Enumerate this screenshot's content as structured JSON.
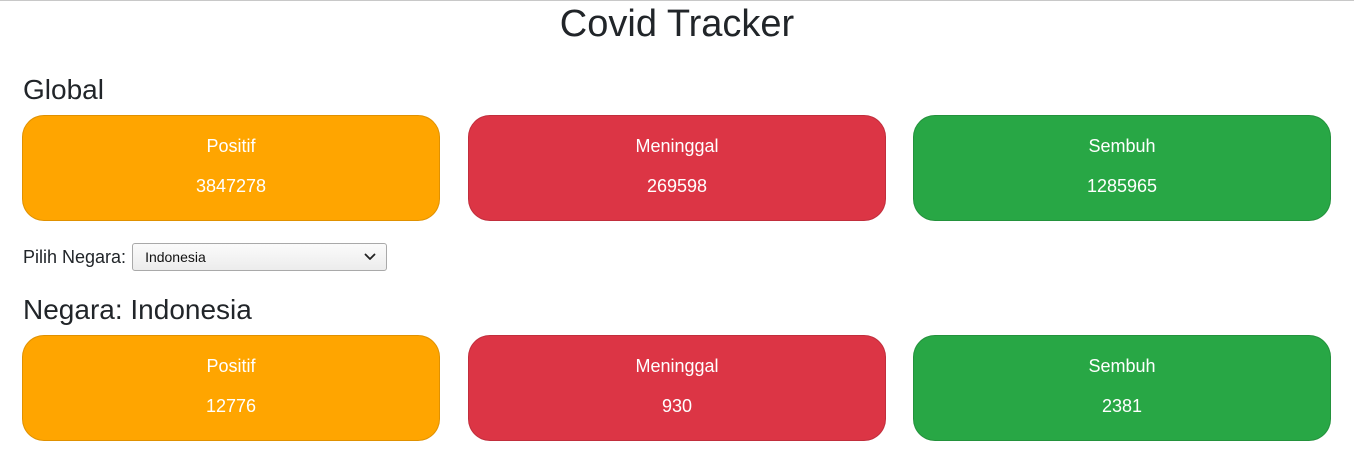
{
  "app": {
    "title": "Covid Tracker"
  },
  "colors": {
    "positive": "#ffa500",
    "deaths": "#dc3545",
    "recovered": "#28a745"
  },
  "global": {
    "title": "Global",
    "cards": [
      {
        "label": "Positif",
        "value": "3847278"
      },
      {
        "label": "Meninggal",
        "value": "269598"
      },
      {
        "label": "Sembuh",
        "value": "1285965"
      }
    ]
  },
  "country_select": {
    "label": "Pilih Negara:",
    "selected": "Indonesia",
    "icon": "chevron-down-icon"
  },
  "country": {
    "title": "Negara: Indonesia",
    "cards": [
      {
        "label": "Positif",
        "value": "12776"
      },
      {
        "label": "Meninggal",
        "value": "930"
      },
      {
        "label": "Sembuh",
        "value": "2381"
      }
    ]
  }
}
